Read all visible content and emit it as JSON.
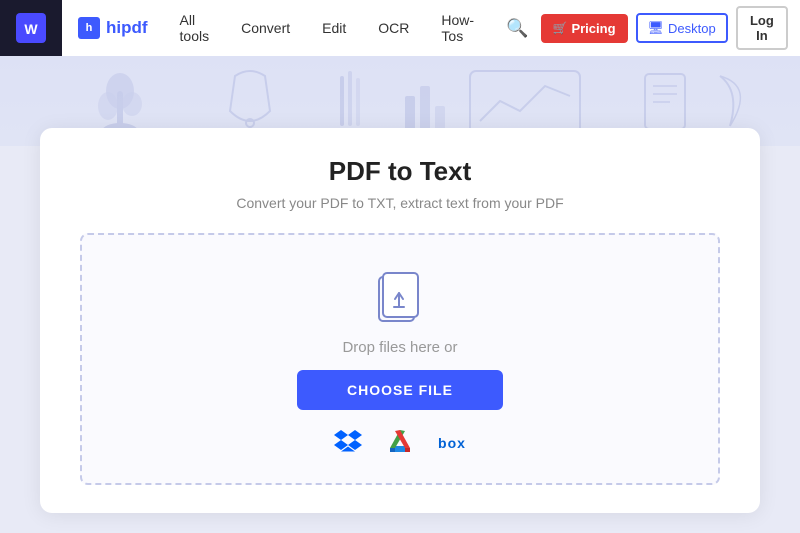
{
  "navbar": {
    "brand": "hipdf",
    "nav_items": [
      {
        "label": "All tools",
        "id": "all-tools"
      },
      {
        "label": "Convert",
        "id": "convert"
      },
      {
        "label": "Edit",
        "id": "edit"
      },
      {
        "label": "OCR",
        "id": "ocr"
      },
      {
        "label": "How-Tos",
        "id": "how-tos"
      }
    ],
    "pricing_label": "Pricing",
    "desktop_label": "Desktop",
    "login_label": "Log In"
  },
  "page": {
    "title": "PDF to Text",
    "subtitle": "Convert your PDF to TXT, extract text from your PDF",
    "drop_text": "Drop files here or",
    "choose_label": "CHOOSE FILE"
  }
}
